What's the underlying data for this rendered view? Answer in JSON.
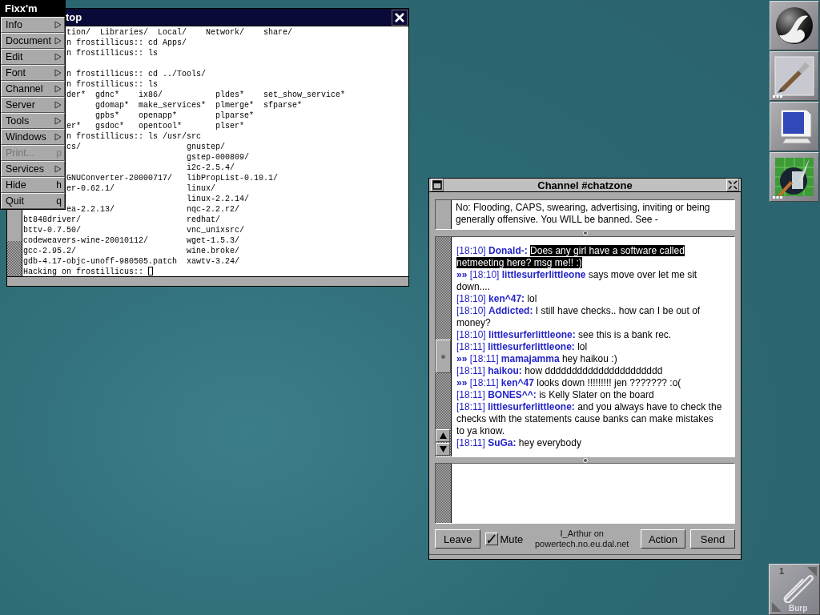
{
  "menu": {
    "title": "Fixx'm",
    "items": [
      {
        "label": "Info",
        "kind": "submenu",
        "disabled": false
      },
      {
        "label": "Document",
        "kind": "submenu",
        "disabled": false
      },
      {
        "label": "Edit",
        "kind": "submenu",
        "disabled": false
      },
      {
        "label": "Font",
        "kind": "submenu",
        "disabled": false
      },
      {
        "label": "Channel",
        "kind": "submenu",
        "disabled": false
      },
      {
        "label": "Server",
        "kind": "submenu",
        "disabled": false
      },
      {
        "label": "Tools",
        "kind": "submenu",
        "disabled": false
      },
      {
        "label": "Windows",
        "kind": "submenu",
        "disabled": false
      },
      {
        "label": "Print...",
        "kind": "shortcut",
        "key": "p",
        "disabled": true
      },
      {
        "label": "Services",
        "kind": "submenu",
        "disabled": false
      },
      {
        "label": "Hide",
        "kind": "shortcut",
        "key": "h",
        "disabled": false
      },
      {
        "label": "Quit",
        "kind": "shortcut",
        "key": "q",
        "disabled": false
      }
    ]
  },
  "terminal": {
    "title": "top",
    "lines": [
      "tion/  Libraries/  Local/    Network/    share/",
      "n frostillicus:: cd Apps/",
      "n frostillicus:: ls",
      "n frostillicus:: cd ../Tools/",
      "n frostillicus:: ls",
      "der*  gdnc*    ix86/           pldes*    set_show_service*",
      "      gdomap*  make_services*  plmerge*  sfparse*",
      "      gpbs*    openapp*        plparse*",
      "er*   gsdoc*   opentool*       plser*",
      "n frostillicus:: ls /usr/src",
      "cs/                      gnustep/",
      "                         gstep-000809/",
      "                         i2c-2.5.4/",
      "GNUConverter-20000717/   libPropList-0.10.1/",
      "er-0.62.1/               linux/",
      "                         linux-2.2.14/",
      "ea-2.2.13/               nqc-2.2.r2/",
      "bt848driver/                      redhat/",
      "bttv-0.7.50/                      vnc_unixsrc/",
      "codeweavers-wine-20010112/        wget-1.5.3/",
      "gcc-2.95.2/                       wine.broke/",
      "gdb-4.17-objc-unoff-980505.patch  xawtv-3.24/",
      "Hacking on frostillicus:: "
    ]
  },
  "chat": {
    "title": "Channel #chatzone",
    "topic": "No: Flooding, CAPS, swearing, advertising, inviting or being generally offensive. You WILL be banned. See -",
    "messages": [
      {
        "kind": "message",
        "time": "[18:10]",
        "nick": "Donald-:",
        "text": "Does any girl have a software called netmeeting here? msg me!! :)",
        "selected": true
      },
      {
        "kind": "action",
        "marker": "»»",
        "time": "[18:10]",
        "nick": "littlesurferlittleone",
        "text": "says move over let me sit down....",
        "selected": false
      },
      {
        "kind": "message",
        "time": "[18:10]",
        "nick": "ken^47:",
        "text": "lol",
        "selected": false
      },
      {
        "kind": "message",
        "time": "[18:10]",
        "nick": "Addicted:",
        "text": "I still have checks.. how can I be out of money?",
        "selected": false
      },
      {
        "kind": "message",
        "time": "[18:10]",
        "nick": "littlesurferlittleone:",
        "text": "see this is a bank rec.",
        "selected": false
      },
      {
        "kind": "message",
        "time": "[18:11]",
        "nick": "littlesurferlittleone:",
        "text": "lol",
        "selected": false
      },
      {
        "kind": "action",
        "marker": "»»",
        "time": "[18:11]",
        "nick": "mamajamma",
        "text": "hey haikou :)",
        "selected": false
      },
      {
        "kind": "message",
        "time": "[18:11]",
        "nick": "haikou:",
        "text": "how dddddddddddddddddddddd",
        "selected": false
      },
      {
        "kind": "action",
        "marker": "»»",
        "time": "[18:11]",
        "nick": "ken^47",
        "text": "looks down !!!!!!!!! jen ??????? :o(",
        "selected": false
      },
      {
        "kind": "message",
        "time": "[18:11]",
        "nick": "BONES^^:",
        "text": "is Kelly Slater on the board",
        "selected": false
      },
      {
        "kind": "message",
        "time": "[18:11]",
        "nick": "littlesurferlittleone:",
        "text": "and you always have to check the checks with the statements cause banks can make mistakes to ya know.",
        "selected": false
      },
      {
        "kind": "message",
        "time": "[18:11]",
        "nick": "SuGa:",
        "text": "hey everybody",
        "selected": false
      }
    ],
    "leave_button": "Leave",
    "mute": {
      "label": "Mute",
      "checked": true
    },
    "status": [
      "I_Arthur on",
      "powertech.no.eu.dal.net"
    ],
    "action_button": "Action",
    "send_button": "Send"
  },
  "dock": [
    {
      "kind": "sphere-logo",
      "running": true
    },
    {
      "kind": "paintbrush",
      "running": false
    },
    {
      "kind": "monitor",
      "running": true
    },
    {
      "kind": "sphere-brush",
      "running": false
    }
  ],
  "clip": {
    "workspace": "1",
    "label": "Burp"
  }
}
